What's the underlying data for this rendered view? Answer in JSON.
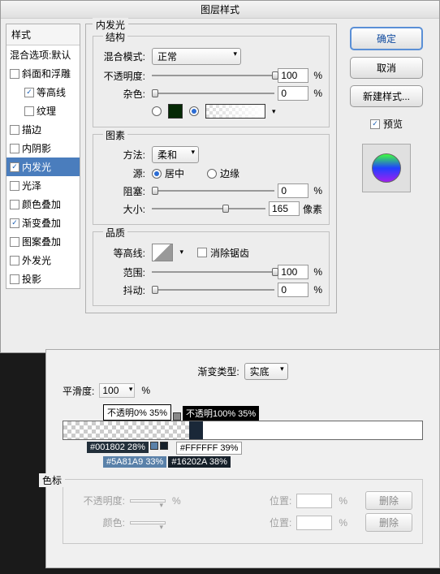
{
  "title": "图层样式",
  "styles_header": "样式",
  "blend_options": "混合选项:默认",
  "style_items": [
    {
      "label": "斜面和浮雕",
      "checked": false
    },
    {
      "label": "等高线",
      "checked": true,
      "indent": true
    },
    {
      "label": "纹理",
      "checked": false,
      "indent": true
    },
    {
      "label": "描边",
      "checked": false
    },
    {
      "label": "内阴影",
      "checked": false
    },
    {
      "label": "内发光",
      "checked": true,
      "selected": true
    },
    {
      "label": "光泽",
      "checked": false
    },
    {
      "label": "颜色叠加",
      "checked": false
    },
    {
      "label": "渐变叠加",
      "checked": true
    },
    {
      "label": "图案叠加",
      "checked": false
    },
    {
      "label": "外发光",
      "checked": false
    },
    {
      "label": "投影",
      "checked": false
    }
  ],
  "panel_title": "内发光",
  "section_structure": "结构",
  "blend_mode_label": "混合模式:",
  "blend_mode_value": "正常",
  "opacity_label": "不透明度:",
  "opacity_value": "100",
  "noise_label": "杂色:",
  "noise_value": "0",
  "pct": "%",
  "section_element": "图素",
  "method_label": "方法:",
  "method_value": "柔和",
  "source_label": "源:",
  "source_center": "居中",
  "source_edge": "边缘",
  "choke_label": "阻塞:",
  "choke_value": "0",
  "size_label": "大小:",
  "size_value": "165",
  "size_unit": "像素",
  "section_quality": "品质",
  "contour_label": "等高线:",
  "antialias_label": "消除锯齿",
  "range_label": "范围:",
  "range_value": "100",
  "jitter_label": "抖动:",
  "jitter_value": "0",
  "ok": "确定",
  "cancel": "取消",
  "new_style": "新建样式...",
  "preview_label": "预览",
  "grad": {
    "type_label": "渐变类型:",
    "type_value": "实底",
    "smooth_label": "平滑度:",
    "smooth_value": "100",
    "op_left": "不透明0% 35%",
    "op_right": "不透明100% 35%",
    "stop1": "#001802 28%",
    "stop2": "#5A81A9 33%",
    "stop3": "#16202A 38%",
    "stop4": "#FFFFFF 39%",
    "stops_title": "色标",
    "opacity_lbl": "不透明度:",
    "position_lbl": "位置:",
    "color_lbl": "颜色:",
    "delete": "删除"
  }
}
